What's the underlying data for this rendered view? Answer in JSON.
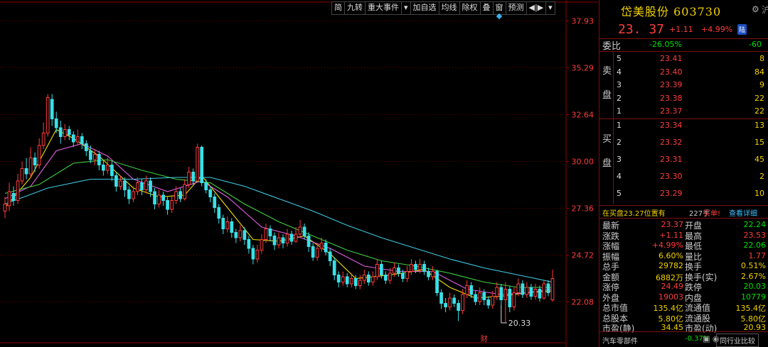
{
  "toolbar": {
    "items": [
      "简",
      "九转",
      "重大事件",
      "▾",
      "加自选",
      "均线",
      "除权",
      "叠",
      "窗",
      "预测",
      "◀|▶",
      "▾"
    ]
  },
  "chart_data": {
    "type": "candlestick",
    "y_ticks": [
      "37.93",
      "35.29",
      "32.64",
      "30.00",
      "27.36",
      "24.72",
      "22.08"
    ],
    "ylim": [
      20.5,
      38.3
    ],
    "n_bars": 129,
    "low_marker": "20.33",
    "low_bar": 116,
    "event_marker": "财",
    "event_bar": 112,
    "candles": [
      [
        27.2,
        27.6,
        28.0,
        26.8
      ],
      [
        27.5,
        28.3,
        28.8,
        27.2
      ],
      [
        28.2,
        27.8,
        28.6,
        27.5
      ],
      [
        27.8,
        28.9,
        29.3,
        27.6
      ],
      [
        28.9,
        29.6,
        30.0,
        28.7
      ],
      [
        29.6,
        29.3,
        30.2,
        29.0
      ],
      [
        29.3,
        30.2,
        30.8,
        29.1
      ],
      [
        30.2,
        29.8,
        30.5,
        29.4
      ],
      [
        29.8,
        30.9,
        31.3,
        29.6
      ],
      [
        30.9,
        31.6,
        32.2,
        30.7
      ],
      [
        31.6,
        33.6,
        33.8,
        31.4
      ],
      [
        33.5,
        32.4,
        33.8,
        32.0
      ],
      [
        32.4,
        31.9,
        32.8,
        31.6
      ],
      [
        31.9,
        31.4,
        32.3,
        31.0
      ],
      [
        31.4,
        31.8,
        32.1,
        31.2
      ],
      [
        31.8,
        31.5,
        32.0,
        31.2
      ],
      [
        31.5,
        31.1,
        31.7,
        30.8
      ],
      [
        31.1,
        31.4,
        31.8,
        30.9
      ],
      [
        31.4,
        31.0,
        31.6,
        30.7
      ],
      [
        31.0,
        30.6,
        31.2,
        30.3
      ],
      [
        30.6,
        30.1,
        30.9,
        29.9
      ],
      [
        30.1,
        30.4,
        30.7,
        29.8
      ],
      [
        30.4,
        29.8,
        30.6,
        29.5
      ],
      [
        29.8,
        29.5,
        30.1,
        29.2
      ],
      [
        29.5,
        29.8,
        30.2,
        29.3
      ],
      [
        29.8,
        29.2,
        30.0,
        28.9
      ],
      [
        29.2,
        28.6,
        29.4,
        28.3
      ],
      [
        28.6,
        28.9,
        29.2,
        28.4
      ],
      [
        28.9,
        28.4,
        29.1,
        28.0
      ],
      [
        28.4,
        27.9,
        28.6,
        27.6
      ],
      [
        27.9,
        28.3,
        28.6,
        27.7
      ],
      [
        28.3,
        28.8,
        29.1,
        28.1
      ],
      [
        28.8,
        28.4,
        29.0,
        28.1
      ],
      [
        28.4,
        28.9,
        29.2,
        28.2
      ],
      [
        28.9,
        28.3,
        29.1,
        28.0
      ],
      [
        28.3,
        27.6,
        28.5,
        27.3
      ],
      [
        27.6,
        28.1,
        28.4,
        27.4
      ],
      [
        28.1,
        27.8,
        28.3,
        27.5
      ],
      [
        27.8,
        27.3,
        28.0,
        27.0
      ],
      [
        27.3,
        27.8,
        28.1,
        27.1
      ],
      [
        27.8,
        28.3,
        28.6,
        27.6
      ],
      [
        28.3,
        27.9,
        28.5,
        27.7
      ],
      [
        27.9,
        28.7,
        29.0,
        27.8
      ],
      [
        28.7,
        29.4,
        29.7,
        28.5
      ],
      [
        29.4,
        28.9,
        29.6,
        28.7
      ],
      [
        28.9,
        30.8,
        31.0,
        28.8
      ],
      [
        30.8,
        28.8,
        30.9,
        28.6
      ],
      [
        28.8,
        28.4,
        29.0,
        28.2
      ],
      [
        28.4,
        28.0,
        28.6,
        27.7
      ],
      [
        28.0,
        27.4,
        28.2,
        27.1
      ],
      [
        27.4,
        26.8,
        27.6,
        26.5
      ],
      [
        26.8,
        26.2,
        27.0,
        25.9
      ],
      [
        26.2,
        26.6,
        26.9,
        26.0
      ],
      [
        26.6,
        26.0,
        26.8,
        25.7
      ],
      [
        26.0,
        25.7,
        26.2,
        25.4
      ],
      [
        25.7,
        26.1,
        26.4,
        25.5
      ],
      [
        26.1,
        25.6,
        26.3,
        25.3
      ],
      [
        25.6,
        25.1,
        25.8,
        24.8
      ],
      [
        25.1,
        24.5,
        25.3,
        24.2
      ],
      [
        24.5,
        25.0,
        25.3,
        24.3
      ],
      [
        25.0,
        25.6,
        25.9,
        24.8
      ],
      [
        25.6,
        26.2,
        26.5,
        25.4
      ],
      [
        26.2,
        25.8,
        26.4,
        25.5
      ],
      [
        25.8,
        25.3,
        26.0,
        25.0
      ],
      [
        25.3,
        25.7,
        26.0,
        25.1
      ],
      [
        25.7,
        25.4,
        25.9,
        25.1
      ],
      [
        25.4,
        25.9,
        26.2,
        25.2
      ],
      [
        25.9,
        25.5,
        26.1,
        25.3
      ],
      [
        25.5,
        25.9,
        26.3,
        25.4
      ],
      [
        25.9,
        26.3,
        26.7,
        25.7
      ],
      [
        26.3,
        25.8,
        26.5,
        25.6
      ],
      [
        25.8,
        25.2,
        26.0,
        24.9
      ],
      [
        25.2,
        24.6,
        25.4,
        24.4
      ],
      [
        24.6,
        25.1,
        25.4,
        24.4
      ],
      [
        25.1,
        25.4,
        25.7,
        24.9
      ],
      [
        25.4,
        24.9,
        25.6,
        24.7
      ],
      [
        24.9,
        24.4,
        25.1,
        24.1
      ],
      [
        24.4,
        23.6,
        24.6,
        23.3
      ],
      [
        23.6,
        23.2,
        23.8,
        22.9
      ],
      [
        23.2,
        23.5,
        23.8,
        23.0
      ],
      [
        23.5,
        23.1,
        23.7,
        22.9
      ],
      [
        23.1,
        23.4,
        23.7,
        22.9
      ],
      [
        23.4,
        23.0,
        23.6,
        22.8
      ],
      [
        23.0,
        23.3,
        23.6,
        22.8
      ],
      [
        23.3,
        23.6,
        23.9,
        23.1
      ],
      [
        23.6,
        23.2,
        23.8,
        23.0
      ],
      [
        23.2,
        23.5,
        23.8,
        23.0
      ],
      [
        23.5,
        24.2,
        24.5,
        23.3
      ],
      [
        24.2,
        23.6,
        24.4,
        23.4
      ],
      [
        23.6,
        23.3,
        23.8,
        23.1
      ],
      [
        23.3,
        23.7,
        24.0,
        23.1
      ],
      [
        23.7,
        24.0,
        24.3,
        23.5
      ],
      [
        24.0,
        23.7,
        24.2,
        23.5
      ],
      [
        23.7,
        23.4,
        23.9,
        23.2
      ],
      [
        23.4,
        23.8,
        24.1,
        23.2
      ],
      [
        23.8,
        24.2,
        24.5,
        23.6
      ],
      [
        24.2,
        23.9,
        24.4,
        23.7
      ],
      [
        23.9,
        24.2,
        24.5,
        23.7
      ],
      [
        24.2,
        23.8,
        24.4,
        23.6
      ],
      [
        23.8,
        23.5,
        24.0,
        23.3
      ],
      [
        23.5,
        23.8,
        24.1,
        23.3
      ],
      [
        23.8,
        22.6,
        23.9,
        22.4
      ],
      [
        22.6,
        22.0,
        22.8,
        21.7
      ],
      [
        22.0,
        21.8,
        22.3,
        21.5
      ],
      [
        21.8,
        22.3,
        22.6,
        21.6
      ],
      [
        22.3,
        22.0,
        22.5,
        21.8
      ],
      [
        22.0,
        21.6,
        22.2,
        21.0
      ],
      [
        21.6,
        22.5,
        22.8,
        21.4
      ],
      [
        22.5,
        23.0,
        23.3,
        22.3
      ],
      [
        23.0,
        22.5,
        23.2,
        22.3
      ],
      [
        22.5,
        22.1,
        22.7,
        21.9
      ],
      [
        22.1,
        22.6,
        22.9,
        21.9
      ],
      [
        22.6,
        22.2,
        22.8,
        21.9
      ],
      [
        22.2,
        21.9,
        22.4,
        21.7
      ],
      [
        21.9,
        22.4,
        22.7,
        21.7
      ],
      [
        22.4,
        22.9,
        23.2,
        22.2
      ],
      [
        22.9,
        22.2,
        23.1,
        21.9
      ],
      [
        22.2,
        22.8,
        23.2,
        20.9
      ],
      [
        22.8,
        21.8,
        23.0,
        21.5
      ],
      [
        21.8,
        22.6,
        22.9,
        21.6
      ],
      [
        22.6,
        23.1,
        23.4,
        22.4
      ],
      [
        23.1,
        22.5,
        23.3,
        22.3
      ],
      [
        22.5,
        22.9,
        23.2,
        22.3
      ],
      [
        22.9,
        22.4,
        23.1,
        22.2
      ],
      [
        22.4,
        22.8,
        23.1,
        22.2
      ],
      [
        22.8,
        22.3,
        23.0,
        22.1
      ],
      [
        22.3,
        23.1,
        23.3,
        22.2
      ],
      [
        23.1,
        22.6,
        23.3,
        22.4
      ],
      [
        22.2,
        23.4,
        23.9,
        22.1
      ]
    ],
    "moving_averages": [
      {
        "color": "#f2e000",
        "values": [
          [
            0,
            27.4
          ],
          [
            6,
            29.1
          ],
          [
            12,
            31.8
          ],
          [
            16,
            31.3
          ],
          [
            22,
            30.3
          ],
          [
            30,
            28.5
          ],
          [
            36,
            28.0
          ],
          [
            42,
            28.1
          ],
          [
            46,
            29.2
          ],
          [
            52,
            27.4
          ],
          [
            58,
            25.6
          ],
          [
            64,
            25.5
          ],
          [
            70,
            25.8
          ],
          [
            76,
            24.8
          ],
          [
            82,
            23.4
          ],
          [
            90,
            23.6
          ],
          [
            98,
            23.9
          ],
          [
            104,
            22.9
          ],
          [
            110,
            22.3
          ],
          [
            116,
            22.4
          ],
          [
            122,
            22.6
          ],
          [
            128,
            22.7
          ]
        ]
      },
      {
        "color": "#e060e0",
        "values": [
          [
            0,
            27.9
          ],
          [
            6,
            28.6
          ],
          [
            12,
            30.6
          ],
          [
            18,
            31.0
          ],
          [
            24,
            30.3
          ],
          [
            30,
            29.0
          ],
          [
            38,
            28.3
          ],
          [
            46,
            28.9
          ],
          [
            52,
            28.0
          ],
          [
            60,
            26.3
          ],
          [
            68,
            25.8
          ],
          [
            76,
            25.1
          ],
          [
            84,
            24.1
          ],
          [
            92,
            23.8
          ],
          [
            100,
            23.8
          ],
          [
            108,
            22.8
          ],
          [
            116,
            22.5
          ],
          [
            122,
            22.6
          ],
          [
            128,
            22.8
          ]
        ]
      },
      {
        "color": "#40d040",
        "values": [
          [
            0,
            28.2
          ],
          [
            8,
            28.7
          ],
          [
            16,
            29.9
          ],
          [
            24,
            30.1
          ],
          [
            32,
            29.5
          ],
          [
            40,
            29.0
          ],
          [
            48,
            28.8
          ],
          [
            56,
            27.6
          ],
          [
            64,
            26.6
          ],
          [
            72,
            25.8
          ],
          [
            80,
            25.0
          ],
          [
            88,
            24.4
          ],
          [
            96,
            24.1
          ],
          [
            104,
            23.7
          ],
          [
            112,
            23.2
          ],
          [
            120,
            22.9
          ],
          [
            128,
            22.9
          ]
        ]
      },
      {
        "color": "#40c8e0",
        "values": [
          [
            0,
            27.6
          ],
          [
            10,
            28.5
          ],
          [
            20,
            29.0
          ],
          [
            30,
            29.0
          ],
          [
            40,
            29.1
          ],
          [
            48,
            29.1
          ],
          [
            56,
            28.6
          ],
          [
            64,
            27.9
          ],
          [
            72,
            27.2
          ],
          [
            80,
            26.4
          ],
          [
            88,
            25.7
          ],
          [
            96,
            25.1
          ],
          [
            104,
            24.5
          ],
          [
            112,
            24.0
          ],
          [
            120,
            23.6
          ],
          [
            128,
            23.2
          ]
        ]
      }
    ]
  },
  "quote": {
    "title": "岱美股份 603730",
    "price": "23. 37",
    "change": "+1.11",
    "change_pct": "+4.99%",
    "badge": "陆",
    "webi_label": "委比",
    "webi_value": "-26.05%",
    "webi_diff": "-60",
    "sell_label": "卖盘",
    "buy_label": "买盘",
    "sell": [
      {
        "lvl": "5",
        "price": "23.41",
        "vol": "8"
      },
      {
        "lvl": "4",
        "price": "23.40",
        "vol": "84"
      },
      {
        "lvl": "3",
        "price": "23.39",
        "vol": "9"
      },
      {
        "lvl": "2",
        "price": "23.38",
        "vol": "22"
      },
      {
        "lvl": "1",
        "price": "23.37",
        "vol": "22"
      }
    ],
    "buy": [
      {
        "lvl": "1",
        "price": "23.34",
        "vol": "13"
      },
      {
        "lvl": "2",
        "price": "23.32",
        "vol": "15"
      },
      {
        "lvl": "3",
        "price": "23.31",
        "vol": "45"
      },
      {
        "lvl": "4",
        "price": "23.30",
        "vol": "2"
      },
      {
        "lvl": "5",
        "price": "23.29",
        "vol": "10"
      }
    ],
    "pos_text": "在买盘23.27位置有",
    "pos_vol": "227手",
    "pos_buy": "买单!",
    "pos_detail": "查看详细",
    "stats": [
      {
        "l1": "最新",
        "v1": "23.37",
        "c1": "#ff3c3c",
        "l2": "开盘",
        "v2": "22.24",
        "c2": "#00e000"
      },
      {
        "l1": "涨跌",
        "v1": "+1.11",
        "c1": "#ff3c3c",
        "l2": "最高",
        "v2": "23.53",
        "c2": "#ff3c3c"
      },
      {
        "l1": "涨幅",
        "v1": "+4.99%",
        "c1": "#ff3c3c",
        "l2": "最低",
        "v2": "22.06",
        "c2": "#00e000"
      },
      {
        "l1": "振幅",
        "v1": "6.60%",
        "c1": "#f2d200",
        "l2": "量比",
        "v2": "1.77",
        "c2": "#ff3c3c"
      },
      {
        "l1": "总手",
        "v1": "29782",
        "c1": "#f2d200",
        "l2": "换手",
        "v2": "0.51%",
        "c2": "#f2d200"
      },
      {
        "l1": "金额",
        "v1": "6882万",
        "c1": "#f2d200",
        "l2": "换手(实)",
        "v2": "2.67%",
        "c2": "#f2d200"
      },
      {
        "l1": "涨停",
        "v1": "24.49",
        "c1": "#ff3c3c",
        "l2": "跌停",
        "v2": "20.03",
        "c2": "#00e000"
      },
      {
        "l1": "外盘",
        "v1": "19003",
        "c1": "#ff3c3c",
        "l2": "内盘",
        "v2": "10779",
        "c2": "#00e000"
      },
      {
        "l1": "总市值",
        "v1": "135.4亿",
        "c1": "#f2d200",
        "l2": "流通值",
        "v2": "135.4亿",
        "c2": "#f2d200"
      },
      {
        "l1": "总股本",
        "v1": "5.80亿",
        "c1": "#f2d200",
        "l2": "流通股",
        "v2": "5.80亿",
        "c2": "#f2d200"
      },
      {
        "l1": "市盈(静)",
        "v1": "34.45",
        "c1": "#f2d200",
        "l2": "市盈(动)",
        "v2": "20.93",
        "c2": "#f2d200"
      }
    ],
    "industry": "汽车零部件",
    "industry_pct": "-0.37%",
    "industry_icons": "▣ ◉",
    "compare": "同行业比较"
  }
}
